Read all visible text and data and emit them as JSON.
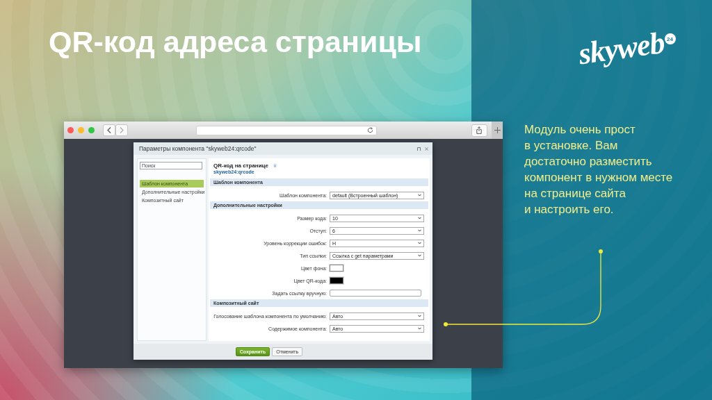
{
  "slide": {
    "title": "QR-код адреса страницы",
    "logo": {
      "text": "skyweb",
      "badge": "24"
    },
    "description": [
      "Модуль очень прост",
      "в установке. Вам",
      "достаточно разместить",
      "компонент в нужном месте",
      "на странице сайта",
      "и настроить его."
    ]
  },
  "dialog": {
    "title": "Параметры компонента \"skyweb24:qrcode\"",
    "search": {
      "placeholder": "Поиск"
    },
    "sidebar": [
      {
        "label": "Шаблон компонента",
        "selected": true
      },
      {
        "label": "Дополнительные настройки",
        "selected": false
      },
      {
        "label": "Композитный сайт",
        "selected": false
      }
    ],
    "heading": "QR-код на странице",
    "component_id": "skyweb24:qrcode",
    "sections": [
      {
        "title": "Шаблон компонента",
        "fields": [
          {
            "label": "Шаблон компонента:",
            "kind": "select",
            "value": "default (Встроенный шаблон)"
          }
        ]
      },
      {
        "title": "Дополнительные настройки",
        "fields": [
          {
            "label": "Размер кода:",
            "kind": "select",
            "value": "10"
          },
          {
            "label": "Отступ:",
            "kind": "select",
            "value": "6"
          },
          {
            "label": "Уровень коррекции ошибок:",
            "kind": "select",
            "value": "H"
          },
          {
            "label": "Тип ссылки:",
            "kind": "select",
            "value": "Ссылка с get параметрами"
          },
          {
            "label": "Цвет фона:",
            "kind": "color",
            "color": "#ffffff"
          },
          {
            "label": "Цвет QR-кода:",
            "kind": "color",
            "color": "#000000"
          },
          {
            "label": "Задать ссылку вручную:",
            "kind": "text"
          }
        ]
      },
      {
        "title": "Композитный сайт",
        "fields": [
          {
            "label": "Голосование шаблона компонента по умолчанию:",
            "kind": "select",
            "value": "Авто"
          },
          {
            "label": "Содержимое компонента:",
            "kind": "select",
            "value": "Авто"
          }
        ]
      }
    ],
    "buttons": [
      {
        "label": "Сохранить",
        "kind": "primary"
      },
      {
        "label": "Отменить",
        "kind": "secondary"
      }
    ]
  }
}
